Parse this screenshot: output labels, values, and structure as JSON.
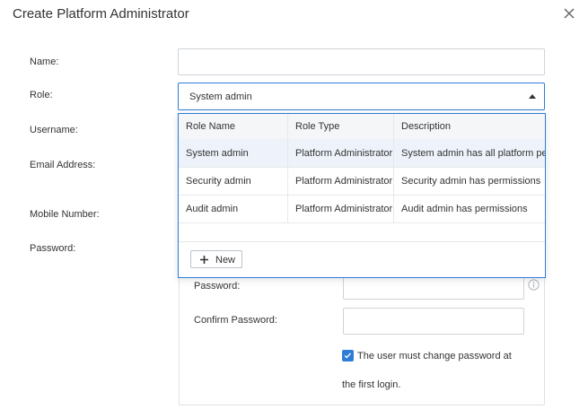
{
  "dialog": {
    "title": "Create Platform Administrator"
  },
  "form": {
    "name_label": "Name:",
    "name_value": "",
    "role_label": "Role:",
    "role_selected": "System admin",
    "username_label": "Username:",
    "email_label": "Email Address:",
    "mobile_label": "Mobile Number:",
    "password_label": "Password:"
  },
  "role_dropdown": {
    "columns": [
      "Role Name",
      "Role Type",
      "Description"
    ],
    "rows": [
      [
        "System admin",
        "Platform Administrator",
        "System admin has all platform permissions"
      ],
      [
        "Security admin",
        "Platform Administrator",
        "Security admin has permissions"
      ],
      [
        "Audit admin",
        "Platform Administrator",
        "Audit admin has permissions"
      ]
    ],
    "new_button": "New"
  },
  "password_panel": {
    "password_label": "Password:",
    "password_value": "",
    "confirm_label": "Confirm Password:",
    "confirm_value": "",
    "must_change_checked": true,
    "must_change_line1": "The user must change password at",
    "must_change_line2": "the first login."
  },
  "icons": {
    "close": "close-icon",
    "caret": "caret-up-icon",
    "plus": "plus-icon",
    "info": "info-icon"
  },
  "colors": {
    "accent": "#2e7dd7",
    "border": "#cfd4da",
    "highlight": "#eef3fb",
    "header_bg": "#f4f6f8"
  }
}
